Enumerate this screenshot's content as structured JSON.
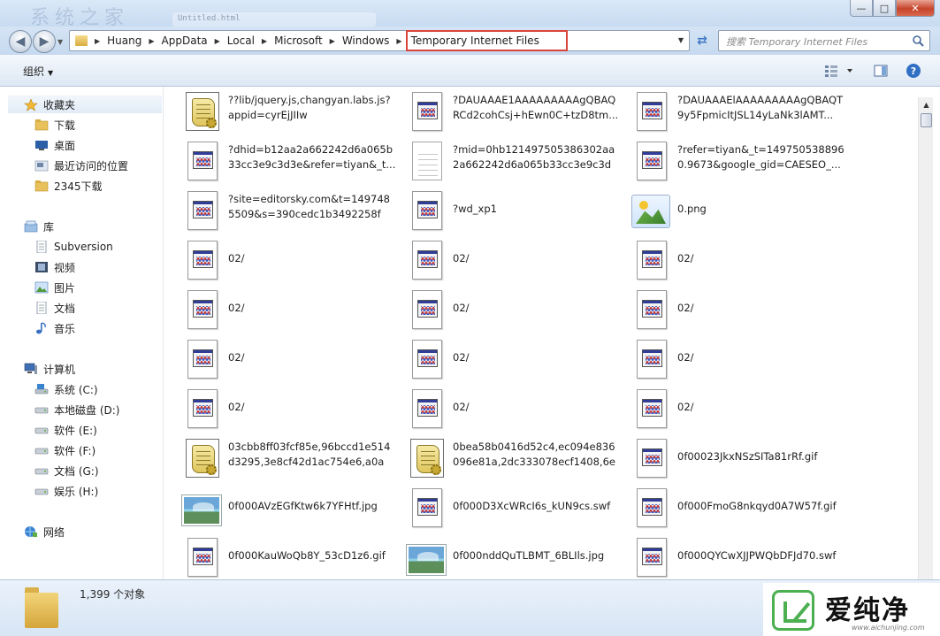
{
  "window": {
    "title_watermark": "系统之家",
    "title_glass_text": "Untitled.html",
    "minimize": "—",
    "maximize": "□",
    "close": "✕"
  },
  "address": {
    "crumbs": [
      "Huang",
      "AppData",
      "Local",
      "Microsoft",
      "Windows"
    ],
    "current": "Temporary Internet Files",
    "search_placeholder": "搜索 Temporary Internet Files"
  },
  "toolbar": {
    "organize": "组织",
    "view_icon": "views-icon",
    "preview_icon": "preview-pane-icon",
    "help_icon": "help-icon"
  },
  "nav": {
    "favorites_header": "收藏夹",
    "favorites": [
      "下载",
      "桌面",
      "最近访问的位置",
      "2345下载"
    ],
    "libraries_header": "库",
    "libraries": [
      "Subversion",
      "视频",
      "图片",
      "文档",
      "音乐"
    ],
    "computer_header": "计算机",
    "drives": [
      "系统 (C:)",
      "本地磁盘 (D:)",
      "软件 (E:)",
      "软件 (F:)",
      "文档 (G:)",
      "娱乐 (H:)"
    ],
    "network_header": "网络"
  },
  "files": [
    {
      "name": "??lib/jquery.js,changyan.labs.js?appid=cyrEjJIIw",
      "type": "script"
    },
    {
      "name": "?DAUAAAE1AAAAAAAAAgQBAQRCd2cohCsj+hEwn0C+tzD8tm...",
      "type": "doc"
    },
    {
      "name": "?DAUAAAElAAAAAAAAAgQBAQT9y5FpmicItJSL14yLaNk3lAMT...",
      "type": "doc"
    },
    {
      "name": "?dhid=b12aa2a662242d6a065b33cc3e9c3d3e&refer=tiyan&_t...",
      "type": "doc"
    },
    {
      "name": "?mid=0hb121497505386302aa2a662242d6a065b33cc3e9c3d3...",
      "type": "blank"
    },
    {
      "name": "?refer=tiyan&_t=1497505388960.9673&google_gid=CAESEO_...",
      "type": "doc"
    },
    {
      "name": "?site=editorsky.com&t=1497485509&s=390cedc1b3492258f8...",
      "type": "doc"
    },
    {
      "name": "?wd_xp1",
      "type": "doc"
    },
    {
      "name": "0.png",
      "type": "png"
    },
    {
      "name": "02/",
      "type": "doc"
    },
    {
      "name": "02/",
      "type": "doc"
    },
    {
      "name": "02/",
      "type": "doc"
    },
    {
      "name": "02/",
      "type": "doc"
    },
    {
      "name": "02/",
      "type": "doc"
    },
    {
      "name": "02/",
      "type": "doc"
    },
    {
      "name": "02/",
      "type": "doc"
    },
    {
      "name": "02/",
      "type": "doc"
    },
    {
      "name": "02/",
      "type": "doc"
    },
    {
      "name": "02/",
      "type": "doc"
    },
    {
      "name": "02/",
      "type": "doc"
    },
    {
      "name": "02/",
      "type": "doc"
    },
    {
      "name": "03cbb8ff03fcf85e,96bccd1e514d3295,3e8cf42d1ac754e6,a0ae...",
      "type": "script"
    },
    {
      "name": "0bea58b0416d52c4,ec094e836096e81a,2dc333078ecf1408,6ed...",
      "type": "script"
    },
    {
      "name": "0f00023JkxNSzSITa81rRf.gif",
      "type": "doc"
    },
    {
      "name": "0f000AVzEGfKtw6k7YFHtf.jpg",
      "type": "img"
    },
    {
      "name": "0f000D3XcWRcI6s_kUN9cs.swf",
      "type": "doc"
    },
    {
      "name": "0f000FmoG8nkqyd0A7W57f.gif",
      "type": "doc"
    },
    {
      "name": "0f000KauWoQb8Y_53cD1z6.gif",
      "type": "doc"
    },
    {
      "name": "0f000nddQuTLBMT_6BLIls.jpg",
      "type": "img"
    },
    {
      "name": "0f000QYCwXJJPWQbDFJd70.swf",
      "type": "doc"
    }
  ],
  "details": {
    "count": "1,399 个对象"
  },
  "watermark": {
    "brand": "爱纯净",
    "url": "www.aichunjing.com"
  }
}
